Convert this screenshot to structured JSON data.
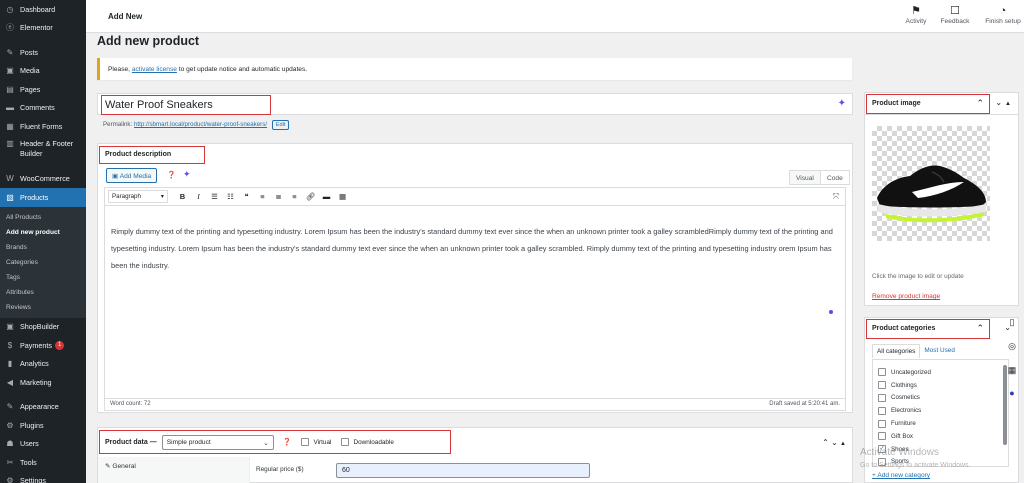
{
  "sidebar": {
    "items": [
      {
        "label": "Dashboard",
        "icon": "dashboard-icon",
        "glyph": "◷"
      },
      {
        "label": "Elementor",
        "icon": "elementor-icon",
        "glyph": "ⓔ"
      },
      {
        "label": "Posts",
        "icon": "pin-icon",
        "glyph": "✎"
      },
      {
        "label": "Media",
        "icon": "media-icon",
        "glyph": "▣"
      },
      {
        "label": "Pages",
        "icon": "pages-icon",
        "glyph": "▤"
      },
      {
        "label": "Comments",
        "icon": "comments-icon",
        "glyph": "▬"
      },
      {
        "label": "Fluent Forms",
        "icon": "forms-icon",
        "glyph": "▦"
      },
      {
        "label": "Header & Footer Builder",
        "icon": "header-footer-icon",
        "glyph": "▥"
      },
      {
        "label": "WooCommerce",
        "icon": "woocommerce-icon",
        "glyph": "W"
      },
      {
        "label": "Products",
        "icon": "products-icon",
        "glyph": "▧"
      }
    ],
    "sub_items": [
      "All Products",
      "Add new product",
      "Brands",
      "Categories",
      "Tags",
      "Attributes",
      "Reviews"
    ],
    "items_after": [
      {
        "label": "ShopBuilder",
        "icon": "shopbuilder-icon",
        "glyph": "▣"
      },
      {
        "label": "Payments",
        "icon": "payments-icon",
        "glyph": "$"
      },
      {
        "label": "Analytics",
        "icon": "analytics-icon",
        "glyph": "▮"
      },
      {
        "label": "Marketing",
        "icon": "marketing-icon",
        "glyph": "◀"
      },
      {
        "label": "Appearance",
        "icon": "appearance-icon",
        "glyph": "✎"
      },
      {
        "label": "Plugins",
        "icon": "plugins-icon",
        "glyph": "⚙"
      },
      {
        "label": "Users",
        "icon": "users-icon",
        "glyph": "☗"
      },
      {
        "label": "Tools",
        "icon": "tools-icon",
        "glyph": "✂"
      },
      {
        "label": "Settings",
        "icon": "settings-icon",
        "glyph": "⚙"
      }
    ],
    "payments_badge": "1"
  },
  "topbar": {
    "title": "Add New",
    "actions": [
      {
        "label": "Activity",
        "icon": "activity-flag-icon",
        "glyph": "⚑"
      },
      {
        "label": "Feedback",
        "icon": "feedback-icon",
        "glyph": "☐"
      },
      {
        "label": "Finish setup",
        "icon": "finish-setup-icon",
        "glyph": "◔"
      }
    ]
  },
  "page_heading": "Add new product",
  "notice": {
    "prefix": "Please,",
    "link": "activate license",
    "suffix": "to get update notice and automatic updates."
  },
  "title_field": {
    "value": "Water Proof Sneakers"
  },
  "permalink": {
    "label": "Permalink:",
    "url": "http://sbmart.local/product/water-proof-sneakers/",
    "edit": "Edit"
  },
  "description": {
    "label": "Product description",
    "add_media": "Add Media",
    "tabs": [
      "Visual",
      "Code"
    ],
    "paragraph_select": "Paragraph",
    "content": "Rimply dummy text of the printing and typesetting industry. Lorem Ipsum has been the industry's standard dummy text ever since the when an unknown printer took a galley scrambledRimply dummy text of the printing and typesetting industry. Lorem Ipsum has been the industry's standard dummy text ever since the when an unknown printer took a galley scrambled. Rimply dummy text of the printing and typesetting industry orem Ipsum has been the industry.",
    "word_count": "Word count: 72",
    "draft_saved": "Draft saved at 5:20:41 am."
  },
  "product_data": {
    "label": "Product data —",
    "type_select": "Simple product",
    "virtual": "Virtual",
    "downloadable": "Downloadable",
    "nav_general": "General",
    "regular_price_label": "Regular price ($)",
    "regular_price_value": "60"
  },
  "product_image": {
    "title": "Product image",
    "note": "Click the image to edit or update",
    "remove": "Remove product image"
  },
  "product_categories": {
    "title": "Product categories",
    "tabs": [
      "All categories",
      "Most Used"
    ],
    "items": [
      {
        "label": "Uncategorized",
        "checked": false
      },
      {
        "label": "Clothings",
        "checked": false
      },
      {
        "label": "Cosmetics",
        "checked": false
      },
      {
        "label": "Electronics",
        "checked": false
      },
      {
        "label": "Furniture",
        "checked": false
      },
      {
        "label": "Gift Box",
        "checked": false
      },
      {
        "label": "Shoes",
        "checked": true
      },
      {
        "label": "Sports",
        "checked": false
      }
    ],
    "add_new": "+ Add new category"
  },
  "watermark": {
    "line1": "Activate Windows",
    "line2": "Go to Settings to activate Windows."
  },
  "colors": {
    "admin_blue": "#2271b1",
    "highlight_red": "#d63638",
    "sidebar_bg": "#1d2327"
  }
}
